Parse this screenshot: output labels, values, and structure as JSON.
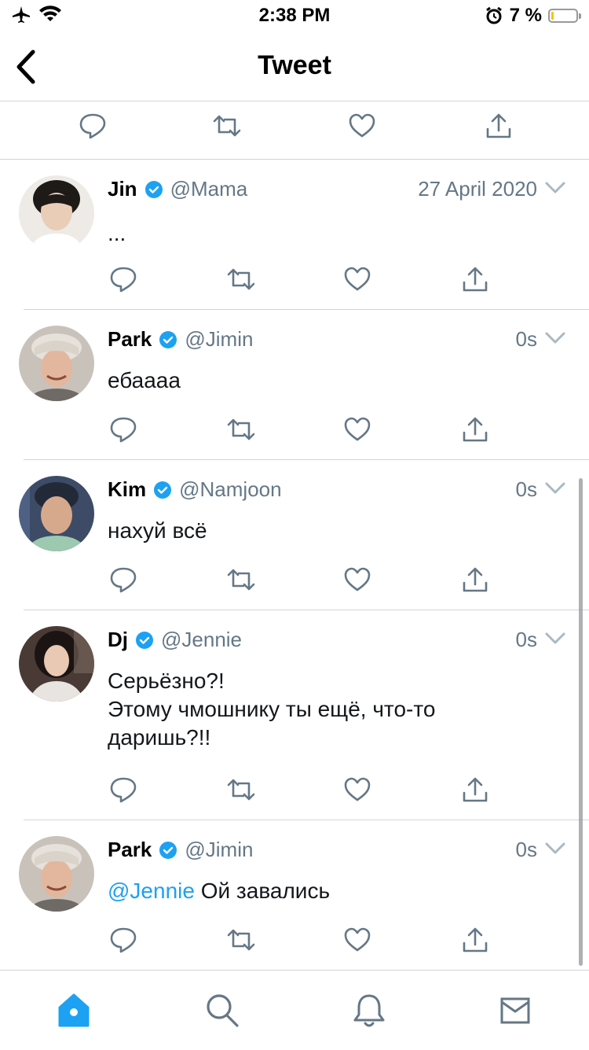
{
  "status_bar": {
    "time": "2:38 PM",
    "battery_percent": "7 %",
    "battery_level": 0.07
  },
  "nav": {
    "title": "Tweet",
    "back_icon": "chevron-left-icon"
  },
  "colors": {
    "accent": "#1da1f2",
    "text": "#14171a",
    "secondary": "#657786",
    "separator": "#cfd4d8"
  },
  "tweets": [
    {
      "name": "Jin",
      "handle": "@Mama",
      "time": "27 April 2020",
      "text_lines": [
        "..."
      ]
    },
    {
      "name": "Park",
      "handle": "@Jimin",
      "time": "0s",
      "text_lines": [
        "ебаааа"
      ]
    },
    {
      "name": "Kim",
      "handle": "@Namjoon",
      "time": "0s",
      "text_lines": [
        "нахуй всё"
      ]
    },
    {
      "name": "Dj",
      "handle": "@Jennie",
      "time": "0s",
      "text_lines": [
        "Серьёзно?!",
        "Этому чмошнику ты ещё, что-то",
        "даришь?!!"
      ]
    },
    {
      "name": "Park",
      "handle": "@Jimin",
      "time": "0s",
      "mention": "@Jennie",
      "text_after_mention": " Ой завались"
    }
  ],
  "tabs": [
    {
      "name": "home",
      "icon": "home-icon",
      "active": true
    },
    {
      "name": "search",
      "icon": "search-icon",
      "active": false
    },
    {
      "name": "notifications",
      "icon": "bell-icon",
      "active": false
    },
    {
      "name": "messages",
      "icon": "mail-icon",
      "active": false
    }
  ]
}
